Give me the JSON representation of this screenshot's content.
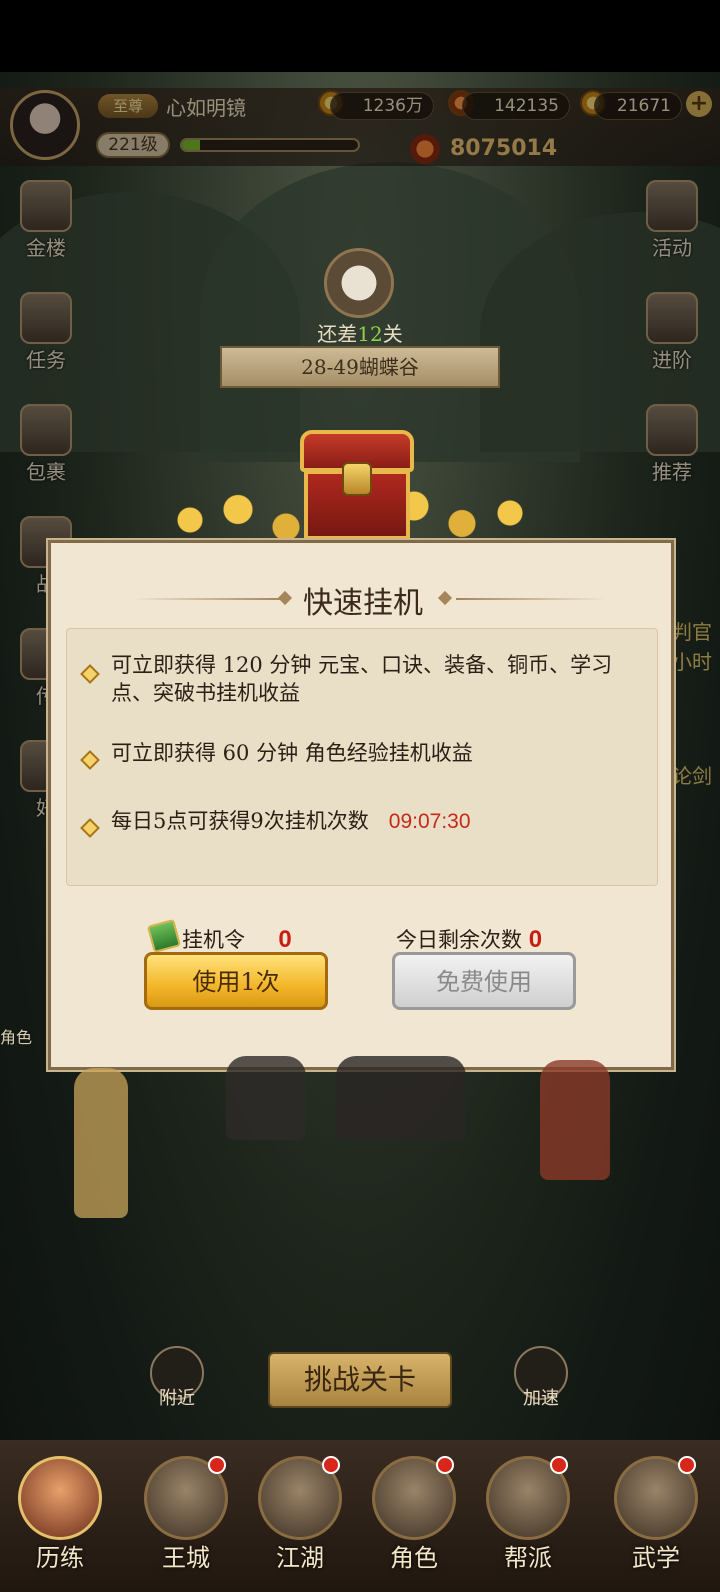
{
  "header": {
    "vip_label": "至尊",
    "player_name": "心如明镜",
    "level": "221级",
    "exp_fraction": 0.1,
    "copper": "1236万",
    "stamina": "142135",
    "gold": "21671",
    "power": "8075014"
  },
  "left_menu": [
    "金楼",
    "任务",
    "包裹",
    "战",
    "传",
    "好"
  ],
  "right_menu": [
    "活动",
    "进阶",
    "推荐"
  ],
  "right_partial": [
    "判官",
    "小时",
    "论剑"
  ],
  "stage": {
    "remain_prefix": "还差",
    "remain_num": "12",
    "remain_suffix": "关",
    "name": "28-49蝴蝶谷"
  },
  "panel": {
    "title": "快速挂机",
    "items": [
      "可立即获得 120 分钟 元宝、口诀、装备、铜币、学习点、突破书挂机收益",
      "可立即获得 60 分钟 角色经验挂机收益",
      "每日5点可获得9次挂机次数"
    ],
    "timer": "09:07:30",
    "token_label": "挂机令",
    "token_count": "0",
    "remain_label": "今日剩余次数",
    "remain_count": "0",
    "use_button": "使用1次",
    "free_button": "免费使用"
  },
  "scene": {
    "challenge_button": "挑战关卡",
    "nearby": "附近",
    "speed_up": "加速",
    "role_partial": "角色"
  },
  "bottom_nav": [
    "历练",
    "王城",
    "江湖",
    "角色",
    "帮派",
    "武学"
  ]
}
